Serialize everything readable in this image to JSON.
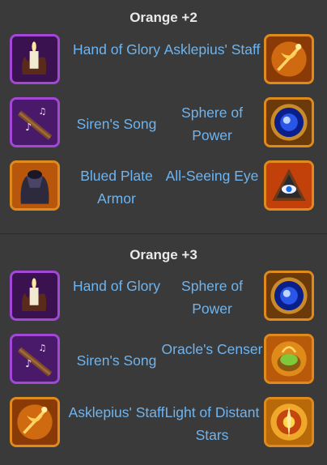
{
  "sections": [
    {
      "title": "Orange +2",
      "rows": [
        {
          "left": {
            "label": "Hand of Glory",
            "icon": "hand-of-glory-icon",
            "rarity": "purple"
          },
          "right": {
            "label": "Asklepius' Staff",
            "icon": "asklepius-staff-icon",
            "rarity": "orange"
          }
        },
        {
          "left": {
            "label": "Siren's Song",
            "icon": "sirens-song-icon",
            "rarity": "purple"
          },
          "right": {
            "label": "Sphere of Power",
            "icon": "sphere-of-power-icon",
            "rarity": "orange"
          }
        },
        {
          "left": {
            "label": "Blued Plate Armor",
            "icon": "blued-plate-armor-icon",
            "rarity": "orange"
          },
          "right": {
            "label": "All-Seeing Eye",
            "icon": "all-seeing-eye-icon",
            "rarity": "orange"
          }
        }
      ]
    },
    {
      "title": "Orange +3",
      "rows": [
        {
          "left": {
            "label": "Hand of Glory",
            "icon": "hand-of-glory-icon",
            "rarity": "purple"
          },
          "right": {
            "label": "Sphere of Power",
            "icon": "sphere-of-power-icon",
            "rarity": "orange"
          }
        },
        {
          "left": {
            "label": "Siren's Song",
            "icon": "sirens-song-icon",
            "rarity": "purple"
          },
          "right": {
            "label": "Oracle's Censer",
            "icon": "oracles-censer-icon",
            "rarity": "orange"
          }
        },
        {
          "left": {
            "label": "Asklepius' Staff",
            "icon": "asklepius-staff-icon",
            "rarity": "orange"
          },
          "right": {
            "label": "Light of Distant Stars",
            "icon": "light-of-distant-stars-icon",
            "rarity": "orange"
          }
        }
      ]
    }
  ],
  "colors": {
    "background": "#3a3a3a",
    "title": "#e9e9e9",
    "item_name": "#6fb4ee",
    "purple_frame": "#a247d6",
    "orange_frame": "#e08a1b"
  }
}
